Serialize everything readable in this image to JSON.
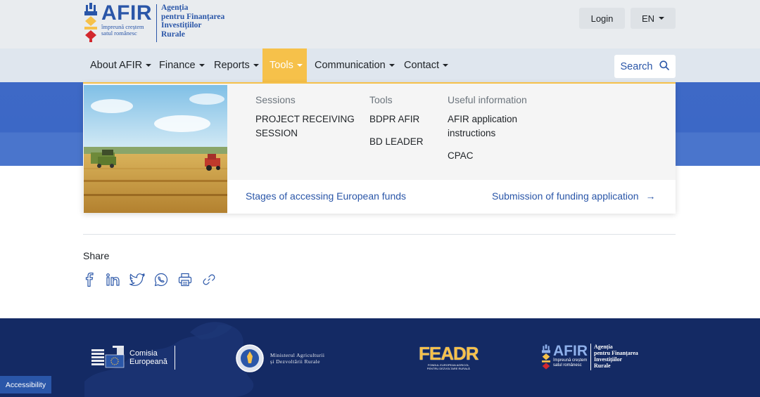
{
  "header": {
    "logo": {
      "brand": "AFIR",
      "tagline_line1": "împreună creștem",
      "tagline_line2": "satul românesc",
      "agency_line1": "Agenția",
      "agency_line2": "pentru Finanțarea",
      "agency_line3": "Investițiilor",
      "agency_line4": "Rurale"
    },
    "login_label": "Login",
    "language_label": "EN"
  },
  "nav": {
    "items": [
      {
        "label": "About AFIR"
      },
      {
        "label": "Finance"
      },
      {
        "label": "Reports"
      },
      {
        "label": "Tools"
      },
      {
        "label": "Communication"
      },
      {
        "label": "Contact"
      }
    ],
    "active_index": 3,
    "search_label": "Search"
  },
  "mega_menu": {
    "sessions": {
      "heading": "Sessions",
      "items": [
        "PROJECT RECEIVING",
        "SESSION"
      ]
    },
    "tools": {
      "heading": "Tools",
      "items": [
        "BDPR AFIR",
        "BD LEADER"
      ]
    },
    "useful": {
      "heading": "Useful information",
      "items": [
        "AFIR application",
        "instructions",
        "CPAC"
      ]
    },
    "footer_left": "Stages of accessing European funds",
    "footer_right": "Submission of funding application",
    "footer_right_arrow": "→"
  },
  "share": {
    "label": "Share",
    "icons": [
      "facebook-icon",
      "linkedin-icon",
      "twitter-icon",
      "whatsapp-icon",
      "print-icon",
      "link-icon"
    ]
  },
  "footer": {
    "logos": {
      "comisia_line1": "Comisia",
      "comisia_line2": "Europeană",
      "minister_line1": "Ministerul Agriculturii",
      "minister_line2": "și Dezvoltării Rurale",
      "feadr_brand": "FEADR",
      "feadr_sub1": "FONDUL EUROPEAN AGRICOL",
      "feadr_sub2": "PENTRU DEZVOLTARE RURALĂ",
      "afir_brand": "AFIR",
      "afir_tag1": "împreună creștem",
      "afir_tag2": "satul românesc",
      "afir_agency1": "Agenția",
      "afir_agency2": "pentru Finanțarea",
      "afir_agency3": "Investițiilor",
      "afir_agency4": "Rurale"
    }
  },
  "accessibility_label": "Accessibility",
  "colors": {
    "brand_blue": "#2a56a8",
    "active_tab": "#f6c14a",
    "footer_bg": "#142a64",
    "banner_blue": "#3e69c6"
  }
}
